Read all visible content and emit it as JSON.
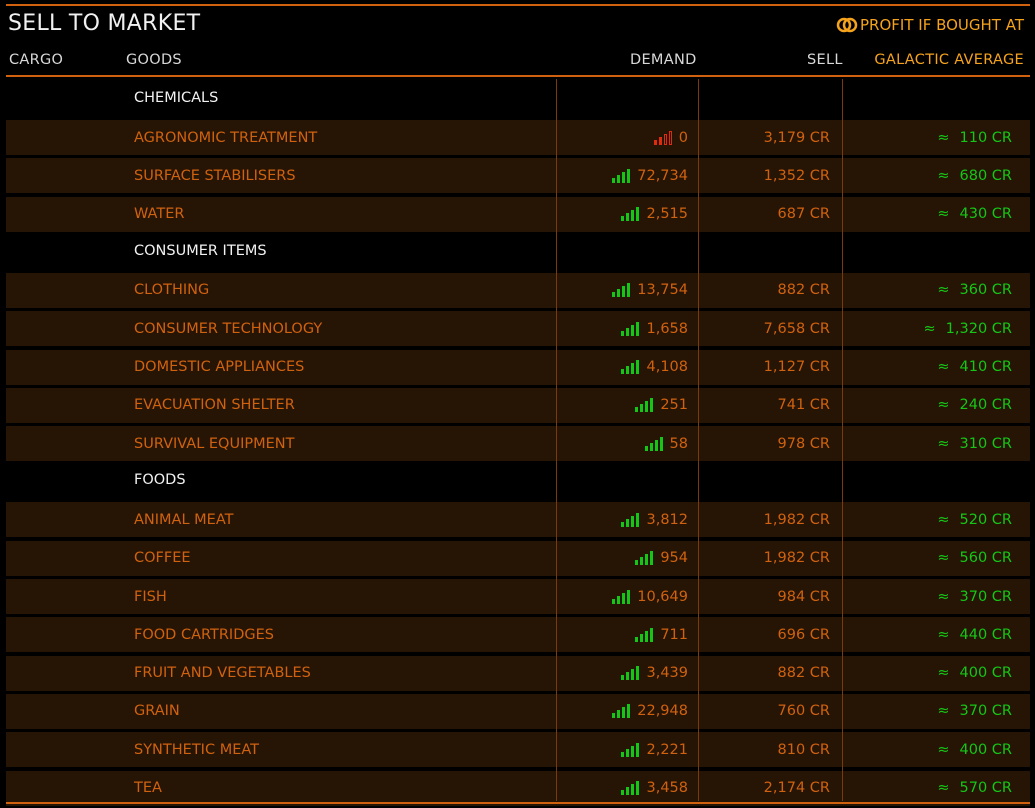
{
  "header": {
    "title": "SELL TO MARKET",
    "profit_label": "PROFIT IF BOUGHT AT"
  },
  "columns": {
    "cargo": "CARGO",
    "goods": "GOODS",
    "demand": "DEMAND",
    "sell": "SELL",
    "galactic_average": "GALACTIC AVERAGE"
  },
  "colors": {
    "accent": "#d0620f",
    "highlight": "#f5a21d",
    "demand_high": "#16c616",
    "demand_none": "#e02b0f"
  },
  "approx_symbol": "≈",
  "rows": [
    {
      "type": "category",
      "name": "CHEMICALS"
    },
    {
      "type": "item",
      "name": "AGRONOMIC TREATMENT",
      "demand_level": "none",
      "demand": "0",
      "sell": "3,179 CR",
      "avg": "110 CR"
    },
    {
      "type": "item",
      "name": "SURFACE STABILISERS",
      "demand_level": "high",
      "demand": "72,734",
      "sell": "1,352 CR",
      "avg": "680 CR"
    },
    {
      "type": "item",
      "name": "WATER",
      "demand_level": "high",
      "demand": "2,515",
      "sell": "687 CR",
      "avg": "430 CR"
    },
    {
      "type": "category",
      "name": "CONSUMER ITEMS"
    },
    {
      "type": "item",
      "name": "CLOTHING",
      "demand_level": "high",
      "demand": "13,754",
      "sell": "882 CR",
      "avg": "360 CR"
    },
    {
      "type": "item",
      "name": "CONSUMER TECHNOLOGY",
      "demand_level": "high",
      "demand": "1,658",
      "sell": "7,658 CR",
      "avg": "1,320 CR"
    },
    {
      "type": "item",
      "name": "DOMESTIC APPLIANCES",
      "demand_level": "high",
      "demand": "4,108",
      "sell": "1,127 CR",
      "avg": "410 CR"
    },
    {
      "type": "item",
      "name": "EVACUATION SHELTER",
      "demand_level": "high",
      "demand": "251",
      "sell": "741 CR",
      "avg": "240 CR"
    },
    {
      "type": "item",
      "name": "SURVIVAL EQUIPMENT",
      "demand_level": "high",
      "demand": "58",
      "sell": "978 CR",
      "avg": "310 CR"
    },
    {
      "type": "category",
      "name": "FOODS"
    },
    {
      "type": "item",
      "name": "ANIMAL MEAT",
      "demand_level": "high",
      "demand": "3,812",
      "sell": "1,982 CR",
      "avg": "520 CR"
    },
    {
      "type": "item",
      "name": "COFFEE",
      "demand_level": "high",
      "demand": "954",
      "sell": "1,982 CR",
      "avg": "560 CR"
    },
    {
      "type": "item",
      "name": "FISH",
      "demand_level": "high",
      "demand": "10,649",
      "sell": "984 CR",
      "avg": "370 CR"
    },
    {
      "type": "item",
      "name": "FOOD CARTRIDGES",
      "demand_level": "high",
      "demand": "711",
      "sell": "696 CR",
      "avg": "440 CR"
    },
    {
      "type": "item",
      "name": "FRUIT AND VEGETABLES",
      "demand_level": "high",
      "demand": "3,439",
      "sell": "882 CR",
      "avg": "400 CR"
    },
    {
      "type": "item",
      "name": "GRAIN",
      "demand_level": "high",
      "demand": "22,948",
      "sell": "760 CR",
      "avg": "370 CR"
    },
    {
      "type": "item",
      "name": "SYNTHETIC MEAT",
      "demand_level": "high",
      "demand": "2,221",
      "sell": "810 CR",
      "avg": "400 CR"
    },
    {
      "type": "item",
      "name": "TEA",
      "demand_level": "high",
      "demand": "3,458",
      "sell": "2,174 CR",
      "avg": "570 CR"
    }
  ]
}
